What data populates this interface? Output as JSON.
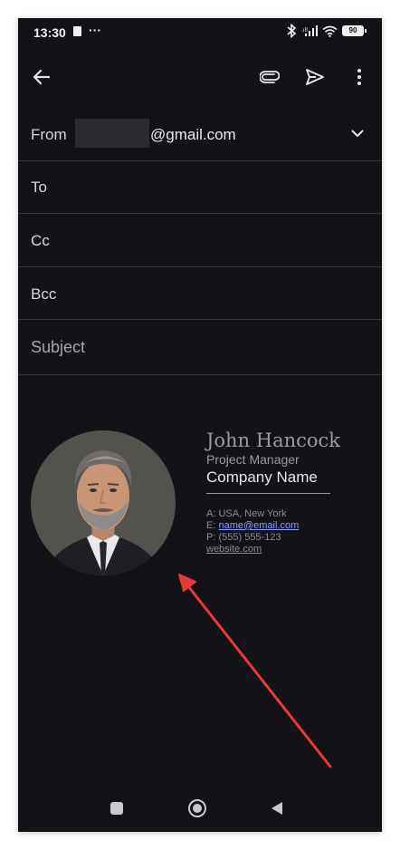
{
  "status_bar": {
    "time": "13:30",
    "dots": "···",
    "battery": "90"
  },
  "compose": {
    "from_label": "From",
    "from_email": "@gmail.com",
    "to_label": "To",
    "cc_label": "Cc",
    "bcc_label": "Bcc",
    "subject_placeholder": "Subject"
  },
  "signature": {
    "name": "John Hancock",
    "role": "Project Manager",
    "company": "Company Name",
    "address_prefix": "A: ",
    "address": "USA, New York",
    "email_prefix": "E: ",
    "email": "name@email.com",
    "phone_prefix": "P: ",
    "phone": "(555) 555-123",
    "website": "website.com"
  },
  "colors": {
    "background": "#121217",
    "annotation_arrow": "#e8383a",
    "link": "#8f9bff"
  },
  "icons": {
    "toolbar": [
      "back-arrow-icon",
      "attach-icon",
      "send-icon",
      "more-vert-icon"
    ],
    "status": [
      "clipboard-icon",
      "bluetooth-icon",
      "signal-icon",
      "wifi-icon",
      "battery-icon"
    ],
    "nav": [
      "recents-square-icon",
      "home-circle-icon",
      "back-triangle-icon"
    ]
  }
}
